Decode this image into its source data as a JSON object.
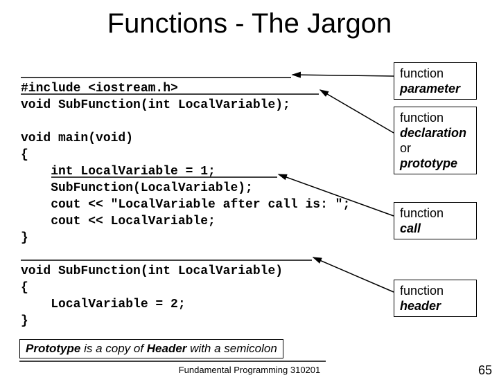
{
  "title": "Functions - The Jargon",
  "code": {
    "l1": "#include <iostream.h>",
    "l2": "void SubFunction(int LocalVariable);",
    "l3": "",
    "l4": "void main(void)",
    "l5": "{",
    "l6": "    int LocalVariable = 1;",
    "l7": "    SubFunction(LocalVariable);",
    "l8": "    cout << \"LocalVariable after call is: \";",
    "l9": "    cout << LocalVariable;",
    "l10": "}",
    "l11": "",
    "l12": "void SubFunction(int LocalVariable)",
    "l13": "{",
    "l14": "    LocalVariable = 2;",
    "l15": "}"
  },
  "labels": {
    "param1": "function",
    "param2": "parameter",
    "decl1": "function",
    "decl2": "declaration",
    "decl3": "or",
    "decl4": "prototype",
    "call1": "function",
    "call2": "call",
    "hdr1": "function",
    "hdr2": "header"
  },
  "note": {
    "t1": "Prototype",
    "t2": " is a copy of ",
    "t3": "Header",
    "t4": "  with a semicolon"
  },
  "footer": "Fundamental Programming 310201",
  "pagenum": "65"
}
